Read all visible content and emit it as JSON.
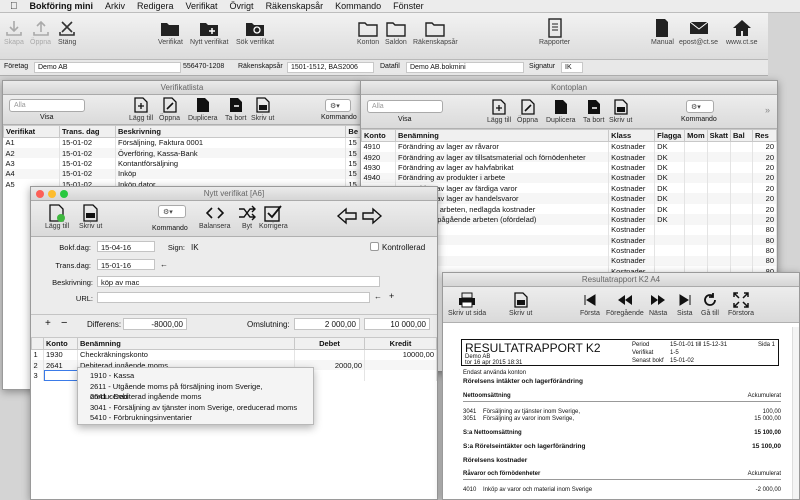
{
  "menubar": {
    "app": "Bokföring mini",
    "items": [
      "Arkiv",
      "Redigera",
      "Verifikat",
      "Övrigt",
      "Räkenskapsår",
      "Kommando",
      "Fönster"
    ]
  },
  "toolbar": {
    "skapa": "Skapa",
    "oppna": "Öppna",
    "stang": "Stäng",
    "verifikat": "Verifikat",
    "nytt": "Nytt verifikat",
    "sok": "Sök verifikat",
    "konton": "Konton",
    "saldon": "Saldon",
    "rakenskapsar": "Räkenskapsår",
    "rapporter": "Rapporter",
    "manual": "Manual",
    "epost": "epost@ct.se",
    "web": "www.ct.se"
  },
  "info": {
    "foretag_label": "Företag",
    "foretag": "Demo AB",
    "orgnr": "556470-1208",
    "rak_label": "Räkenskapsår",
    "rak": "1501-1512, BAS2006",
    "datafil_label": "Datafil",
    "datafil": "Demo AB.bokmini",
    "signatur_label": "Signatur",
    "signatur": "IK"
  },
  "verlista": {
    "title": "Verifikatlista",
    "filter": "Alla",
    "visa": "Visa",
    "btns": [
      "Lägg till",
      "Öppna",
      "Duplicera",
      "Ta bort",
      "Skriv ut",
      "Kommando"
    ],
    "cols": [
      "Verifikat",
      "Trans. dag",
      "Beskrivning",
      "Be"
    ],
    "rows": [
      [
        "A1",
        "15-01-02",
        "Försäljning, Faktura 0001",
        "15"
      ],
      [
        "A2",
        "15-01-02",
        "Överföring, Kassa-Bank",
        "15"
      ],
      [
        "A3",
        "15-01-02",
        "Kontantförsäljning",
        "15"
      ],
      [
        "A4",
        "15-01-02",
        "Inköp",
        "15"
      ],
      [
        "A5",
        "15-01-02",
        "Inköp dator",
        "15"
      ]
    ]
  },
  "kontoplan": {
    "title": "Kontoplan",
    "filter": "Alla",
    "visa": "Visa",
    "btns": [
      "Lägg till",
      "Öppna",
      "Duplicera",
      "Ta bort",
      "Skriv ut",
      "Kommando"
    ],
    "cols": [
      "Konto",
      "Benämning",
      "Klass",
      "Flagga",
      "Mom",
      "Skatt",
      "Bal",
      "Res"
    ],
    "rows": [
      [
        "4910",
        "Förändring av lager av råvaror",
        "Kostnader",
        "DK",
        "",
        "",
        "",
        "20"
      ],
      [
        "4920",
        "Förändring av lager av tillsatsmaterial och förnödenheter",
        "Kostnader",
        "DK",
        "",
        "",
        "",
        "20"
      ],
      [
        "4930",
        "Förändring av lager av halvfabrikat",
        "Kostnader",
        "DK",
        "",
        "",
        "",
        "20"
      ],
      [
        "4940",
        "Förändring av produkter i arbete",
        "Kostnader",
        "DK",
        "",
        "",
        "",
        "20"
      ],
      [
        "4950",
        "Förändring av lager av färdiga varor",
        "Kostnader",
        "DK",
        "",
        "",
        "",
        "20"
      ],
      [
        "",
        "Förändring av lager av handelsvaror",
        "Kostnader",
        "DK",
        "",
        "",
        "",
        "20"
      ],
      [
        "",
        "...pågående arbeten, nedlagda kostnader",
        "Kostnader",
        "DK",
        "",
        "",
        "",
        "20"
      ],
      [
        "",
        "...lager och pågående arbeten (ofördelad)",
        "Kostnader",
        "DK",
        "",
        "",
        "",
        "20"
      ],
      [
        "",
        "",
        "Kostnader",
        "",
        "",
        "",
        "",
        "80"
      ],
      [
        "",
        "",
        "Kostnader",
        "",
        "",
        "",
        "",
        "80"
      ],
      [
        "",
        "",
        "Kostnader",
        "",
        "",
        "",
        "",
        "80"
      ],
      [
        "",
        "",
        "Kostnader",
        "",
        "",
        "",
        "",
        "80"
      ],
      [
        "",
        "",
        "Kostnader",
        "",
        "",
        "",
        "",
        "80"
      ]
    ]
  },
  "nyttver": {
    "title": "Nytt verifikat [A6]",
    "btns": [
      "Lägg till",
      "Skriv ut",
      "Kommando",
      "Balansera",
      "Byt",
      "Korrigera"
    ],
    "bokf_label": "Bokf.dag:",
    "bokf": "15-04-16",
    "sign_label": "Sign:",
    "sign": "IK",
    "kontrollerad": "Kontrollerad",
    "trans_label": "Trans.dag:",
    "trans": "15-01-16",
    "besk_label": "Beskrivning:",
    "besk": "köp av mac",
    "url_label": "URL:",
    "url": "",
    "diff_label": "Differens:",
    "diff": "-8000,00",
    "oms_label": "Omslutning:",
    "oms_debet": "2 000,00",
    "oms_kredit": "10 000,00",
    "cols": [
      "",
      "Konto",
      "Benämning",
      "Debet",
      "Kredit"
    ],
    "rows": [
      [
        "1",
        "1930",
        "Checkräkningskonto",
        "",
        "10000,00"
      ],
      [
        "2",
        "2641",
        "Debiterad ingående moms",
        "2000,00",
        ""
      ],
      [
        "3",
        "",
        "",
        "",
        ""
      ]
    ]
  },
  "dropdown": [
    "1910 - Kassa",
    "2611 - Utgående moms på försäljning inom Sverige, oreducerad",
    "2641 - Debiterad ingående moms",
    "3041 - Försäljning av tjänster inom Sverige, oreducerad moms",
    "5410 - Förbrukningsinventarier"
  ],
  "resultat": {
    "title": "Resultatrapport K2 A4",
    "btns": [
      "Skriv ut sida",
      "Skriv ut",
      "Första",
      "Föregående",
      "Nästa",
      "Sista",
      "Gå till",
      "Förstora"
    ],
    "heading": "RESULTATRAPPORT K2",
    "company": "Demo AB",
    "printed": "tor 16 apr 2015  18:31",
    "period_label": "Period",
    "period": "15-01-01 till 15-12-31",
    "page": "Sida 1",
    "ver_label": "Verifikat",
    "ver": "1-5",
    "senast_label": "Senast bokf",
    "senast": "15-01-02",
    "note": "Endast använda konton",
    "s1": "Rörelsens intäkter och lagerförändring",
    "netto": "Nettoomsättning",
    "ack": "Ackumulerat",
    "l1k": "3041",
    "l1": "Försäljning av tjänster inom Sverige,",
    "l1v": "100,00",
    "l2k": "3051",
    "l2": "Försäljning av varor inom Sverige,",
    "l2v": "15 000,00",
    "sum1": "S:a Nettoomsättning",
    "sum1v": "15 100,00",
    "sum2": "S:a Rörelseintäkter och lagerförändring",
    "sum2v": "15 100,00",
    "s2": "Rörelsens kostnader",
    "raror": "Råvaror och förnödenheter",
    "ack2": "Ackumulerat",
    "l3k": "4010",
    "l3": "Inköp av varor och material inom Sverige",
    "l3v": "-2 000,00"
  }
}
